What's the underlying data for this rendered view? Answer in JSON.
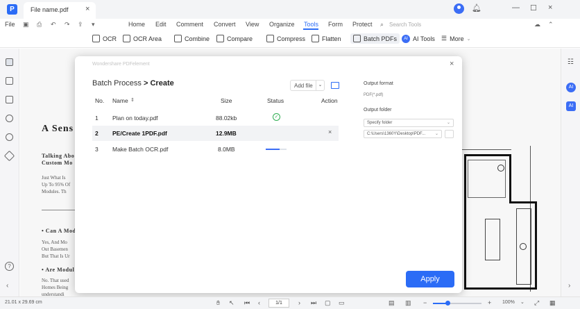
{
  "window": {
    "tab_title": "File name.pdf",
    "close_glyph": "×",
    "minimize_glyph": "—",
    "maximize_glyph": "☐",
    "icons": [
      "avatar-icon",
      "bell-icon",
      "minimize-icon",
      "maximize-icon",
      "close-icon"
    ]
  },
  "menubar": {
    "file_label": "File",
    "items": [
      "Home",
      "Edit",
      "Comment",
      "Convert",
      "View",
      "Organize",
      "Tools",
      "Form",
      "Protect"
    ],
    "active": "Tools",
    "search_placeholder": "Search Tools"
  },
  "toolbar": {
    "items": [
      "OCR",
      "OCR Area",
      "Combine",
      "Compare",
      "Compress",
      "Flatten",
      "Batch PDFs",
      "AI Tools",
      "More"
    ],
    "active": "Batch PDFs",
    "ai_badge": "AI"
  },
  "document": {
    "heading": "A Sens",
    "lines_1": [
      "Talking Abo",
      "Custom Mo"
    ],
    "lines_2": [
      "Just What Is",
      "Up To 95% Of",
      "Modules. Th"
    ],
    "sub_1": "• Can A Mod",
    "lines_3": [
      "Yes, And Mo",
      "Out Basemen",
      "But That Is Ur"
    ],
    "sub_2": "• Are Modul",
    "lines_4": [
      "No. That used",
      "Homes Being",
      "understandi"
    ]
  },
  "modal": {
    "brand": "Wondershare PDFelement",
    "close_glyph": "×",
    "title_parent": "Batch Process",
    "title_sep": ">",
    "title_current": "Create",
    "add_file_label": "Add file",
    "add_file_caret": "⌄",
    "columns": {
      "no": "No.",
      "name": "Name",
      "sort_glyph": "⇕",
      "size": "Size",
      "status": "Status",
      "action": "Action"
    },
    "rows": [
      {
        "no": "1",
        "name": "Plan on today.pdf",
        "size": "88.02kb",
        "status": "done",
        "status_glyph": "✓"
      },
      {
        "no": "2",
        "name": "PE/Create 1PDF.pdf",
        "size": "12.9MB",
        "status": "pending",
        "action_glyph": "×"
      },
      {
        "no": "3",
        "name": "Make Batch OCR.pdf",
        "size": "8.0MB",
        "status": "processing",
        "progress": 0.65
      }
    ],
    "output_format_label": "Output format",
    "output_format_value": "PDF(*.pdf)",
    "output_folder_label": "Output folder",
    "folder_mode": "Specify folder",
    "folder_path": "C:\\Users\\1360Y\\Desktop\\PDF...",
    "select_chevron": "⌄",
    "apply_label": "Apply"
  },
  "statusbar": {
    "dimensions": "21.01 x 29.69 cm",
    "page_indicator": "1/1",
    "zoom": "100%",
    "zoom_level": 0.3,
    "zoom_minus": "−",
    "zoom_plus": "+",
    "nav": {
      "first": "⏮",
      "prev": "‹",
      "next": "›",
      "last": "⏭"
    }
  },
  "colors": {
    "accent": "#2b6cf6",
    "success": "#2fae52",
    "selected_row": "#f2f3f5"
  }
}
